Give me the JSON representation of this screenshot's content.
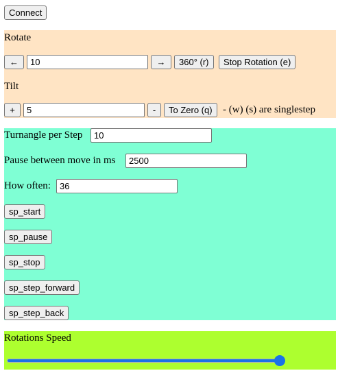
{
  "connect_label": "Connect",
  "rotate": {
    "title": "Rotate",
    "left_arrow": "←",
    "angle_value": "10",
    "right_arrow": "→",
    "full_turn_label": "360° (r)",
    "stop_label": "Stop Rotation (e)"
  },
  "tilt": {
    "title": "Tilt",
    "plus_label": "+",
    "tilt_value": "5",
    "minus_label": "-",
    "zero_label": "To Zero (q)",
    "hint": "- (w) (s) are singlestep"
  },
  "step": {
    "turnangle_label": "Turnangle per Step",
    "turnangle_value": "10",
    "pause_label": "Pause between move in ms",
    "pause_value": "2500",
    "often_label": "How often:",
    "often_value": "36",
    "start_label": "sp_start",
    "pause_btn_label": "sp_pause",
    "stop_btn_label": "sp_stop",
    "forward_label": "sp_step_forward",
    "back_label": "sp_step_back"
  },
  "speed": {
    "title": "Rotations Speed",
    "fraction": 1.0
  },
  "colors": {
    "rotate_bg": "#ffe4c4",
    "step_bg": "#7fffd4",
    "speed_bg": "#adff2f",
    "accent": "#1a73e8"
  }
}
